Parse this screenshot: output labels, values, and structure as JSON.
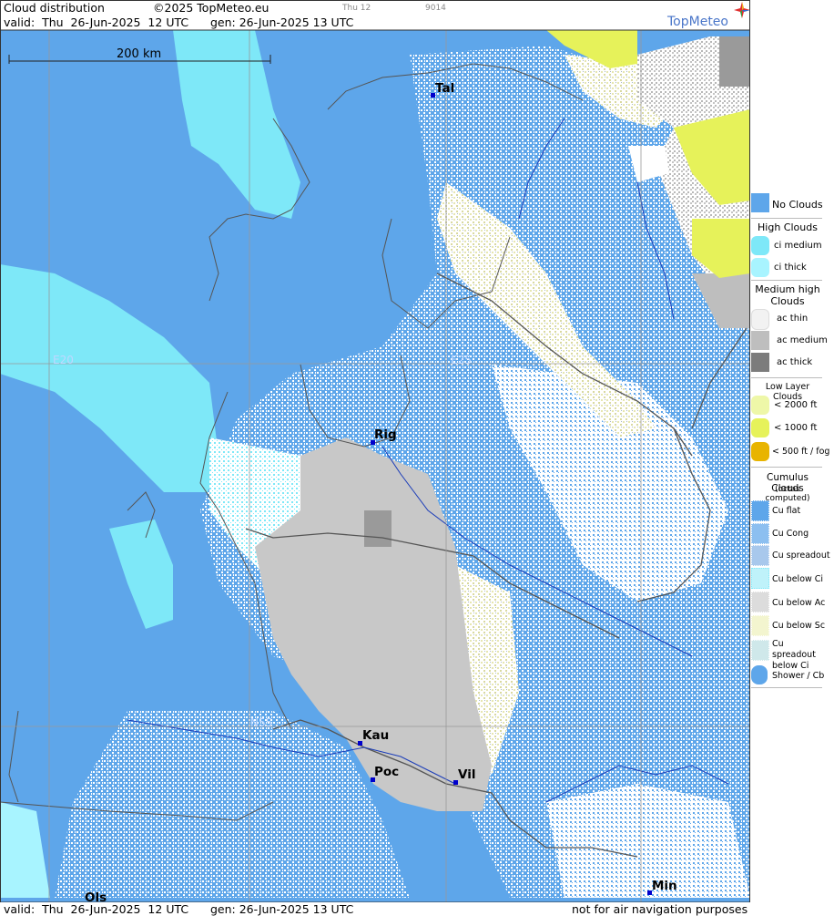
{
  "header": {
    "title": "Cloud distribution",
    "copyright": "©2025 TopMeteo.eu",
    "small_time": "Thu 12",
    "small_code": "9014",
    "valid": "valid:  Thu  26-Jun-2025  12 UTC",
    "gen": "gen: 26-Jun-2025 13 UTC",
    "brand": "TopMeteo"
  },
  "footer": {
    "valid": "valid:  Thu  26-Jun-2025  12 UTC",
    "gen": "gen: 26-Jun-2025 13 UTC",
    "disclaimer": "not for air navigation purposes"
  },
  "map": {
    "scale_label": "200 km",
    "meridians": [
      "E20",
      "E25"
    ],
    "parallel": "N55",
    "cities": [
      {
        "name": "Tal"
      },
      {
        "name": "Rig"
      },
      {
        "name": "Kau"
      },
      {
        "name": "Poc"
      },
      {
        "name": "Vil"
      },
      {
        "name": "Min"
      },
      {
        "name": "Ols"
      }
    ]
  },
  "legend": {
    "no_clouds": "No Clouds",
    "high_clouds": "High Clouds",
    "ci_medium": "ci medium",
    "ci_thick": "ci thick",
    "medium_high": "Medium high Clouds",
    "ac_thin": "ac thin",
    "ac_medium": "ac medium",
    "ac_thick": "ac thick",
    "low_layer": "Low Layer Clouds",
    "lt2000": "< 2000 ft",
    "lt1000": "< 1000 ft",
    "lt500": "< 500 ft / fog",
    "cumulus": "Cumulus Clouds",
    "cumulus_sub": "(octas computed)",
    "cu_flat": "Cu flat",
    "cu_cong": "Cu Cong",
    "cu_spreadout": "Cu spreadout",
    "cu_below_ci": "Cu below Ci",
    "cu_below_ac": "Cu below Ac",
    "cu_below_sc": "Cu below Sc",
    "cu_spreadout_below_ci": "Cu spreadout below Ci",
    "shower_cb": "Shower / Cb"
  },
  "colors": {
    "no_clouds": "#5ea6ea",
    "ci_medium": "#7ee8f8",
    "ci_thick": "#a8f4ff",
    "ac_thin": "#f2f2f2",
    "ac_medium": "#bebebe",
    "ac_thick": "#7c7c7c",
    "lt2000": "#eef7a8",
    "lt1000": "#e6f25a",
    "lt500": "#e8b400",
    "cu_white": "#ffffff",
    "river": "#1a3cb8",
    "border": "#555555",
    "grid": "#999999"
  }
}
